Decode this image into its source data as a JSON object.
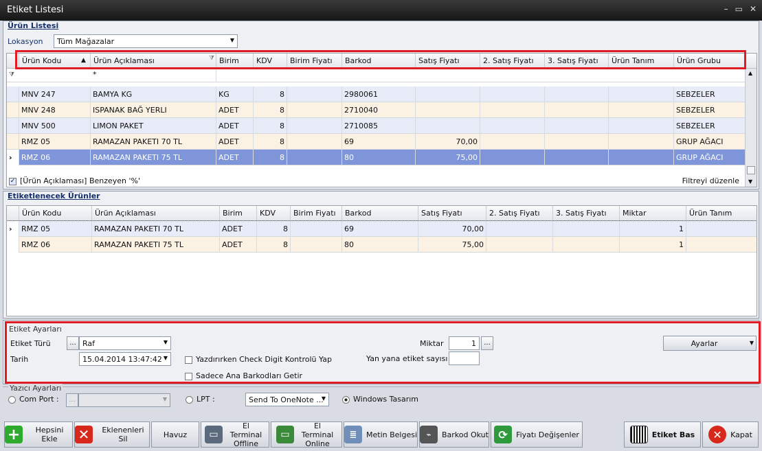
{
  "window": {
    "title": "Etiket Listesi",
    "min": "–",
    "max": "▭",
    "close": "✕"
  },
  "urun": {
    "section_title": "Ürün Listesi",
    "lokasyon_label": "Lokasyon",
    "lokasyon_value": "Tüm Mağazalar",
    "columns": [
      "Ürün Kodu",
      "Ürün Açıklaması",
      "Birim",
      "KDV",
      "Birim Fiyatı",
      "Barkod",
      "Satış Fiyatı",
      "2. Satış Fiyatı",
      "3. Satış Fiyatı",
      "Ürün Tanım",
      "Ürün Grubu"
    ],
    "filter_value": "*",
    "rows": [
      [
        "MNV 247",
        "BAMYA KG",
        "KG",
        "8",
        "",
        "2980061",
        "",
        "",
        "",
        "",
        "SEBZELER"
      ],
      [
        "MNV 248",
        "ISPANAK BAĞ YERLI",
        "ADET",
        "8",
        "",
        "2710040",
        "",
        "",
        "",
        "",
        "SEBZELER"
      ],
      [
        "MNV 500",
        "LIMON PAKET",
        "ADET",
        "8",
        "",
        "2710085",
        "",
        "",
        "",
        "",
        "SEBZELER"
      ],
      [
        "RMZ 05",
        "RAMAZAN PAKETI 70 TL",
        "ADET",
        "8",
        "",
        "69",
        "70,00",
        "",
        "",
        "",
        "GRUP AĞACI"
      ],
      [
        "RMZ 06",
        "RAMAZAN PAKETI 75 TL",
        "ADET",
        "8",
        "",
        "80",
        "75,00",
        "",
        "",
        "",
        "GRUP AĞACI"
      ]
    ],
    "filter_text": "[Ürün Açıklaması] Benzeyen '%'",
    "filter_edit": "Filtreyi düzenle"
  },
  "etiketlenecek": {
    "section_title": "Etiketlenecek Ürünler",
    "columns": [
      "Ürün Kodu",
      "Ürün Açıklaması",
      "Birim",
      "KDV",
      "Birim Fiyatı",
      "Barkod",
      "Satış Fiyatı",
      "2. Satış Fiyatı",
      "3. Satış Fiyatı",
      "Miktar",
      "Ürün Tanım"
    ],
    "rows": [
      [
        "RMZ 05",
        "RAMAZAN PAKETI 70 TL",
        "ADET",
        "8",
        "",
        "69",
        "70,00",
        "",
        "",
        "1",
        ""
      ],
      [
        "RMZ 06",
        "RAMAZAN PAKETI 75 TL",
        "ADET",
        "8",
        "",
        "80",
        "75,00",
        "",
        "",
        "1",
        ""
      ]
    ]
  },
  "etiket_ayarlari": {
    "group_title": "Etiket Ayarları",
    "etiket_turu_label": "Etiket Türü",
    "etiket_turu_value": "Raf",
    "tarih_label": "Tarih",
    "tarih_value": "15.04.2014 13:47:42",
    "check_digit_label": "Yazdırırken Check Digit Kontrolü Yap",
    "ana_barkod_label": "Sadece Ana Barkodları Getir",
    "miktar_label": "Miktar",
    "miktar_value": "1",
    "yanyana_label": "Yan yana etiket sayısı",
    "ayarlar_label": "Ayarlar",
    "dots": "..."
  },
  "yazici": {
    "group_title": "Yazıcı Ayarları",
    "com_port_label": "Com Port :",
    "lpt_label": "LPT :",
    "lpt_value": "Send To OneNote ...",
    "windows_label": "Windows Tasarım"
  },
  "buttons": {
    "hepsini_ekle": "Hepsini Ekle",
    "eklenenleri_sil": "Eklenenleri Sil",
    "havuz": "Havuz",
    "el_terminal_offline": "El Terminal Offline",
    "el_terminal_online": "El Terminal Online",
    "metin_belgesi": "Metin Belgesi",
    "barkod_okut": "Barkod Okut",
    "fiyati_degisenler": "Fiyatı Değişenler",
    "etiket_bas": "Etiket Bas",
    "kapat": "Kapat"
  },
  "colors": {
    "row_a": "#e8ebf8",
    "row_b": "#fbf2e4",
    "selected": "#7f95d9",
    "highlight": "#e01b24"
  }
}
